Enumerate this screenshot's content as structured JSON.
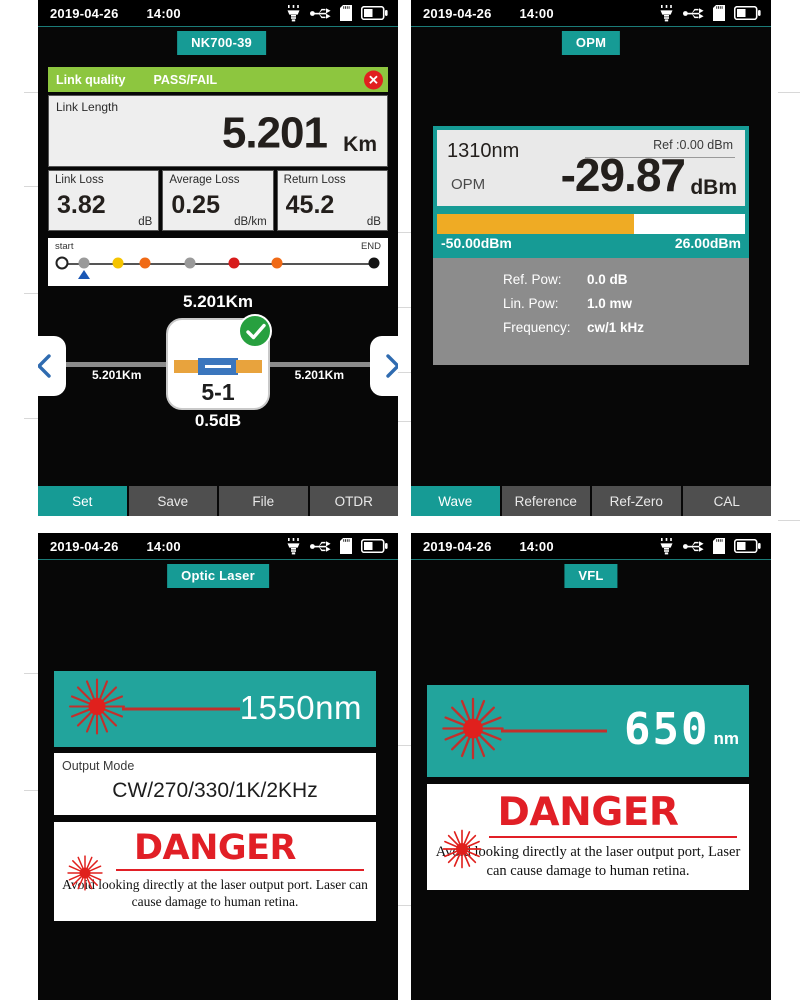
{
  "sheet": {
    "background": "#ffffff",
    "accent_teal": "#169b95",
    "danger_red": "#e11f26",
    "pass_green": "#8dc63f"
  },
  "status_bar": {
    "date": "2019-04-26",
    "time": "14:00",
    "icons": [
      "lamp-icon",
      "usb-icon",
      "sd-card-icon",
      "battery-icon"
    ]
  },
  "panel_otdr": {
    "title": "NK700-39",
    "link_quality": {
      "label": "Link quality",
      "verdict": "PASS/FAIL",
      "close_glyph": "✕"
    },
    "link_length": {
      "label": "Link Length",
      "value": "5.201",
      "unit": "Km"
    },
    "metrics": [
      {
        "label": "Link Loss",
        "value": "3.82",
        "unit": "dB"
      },
      {
        "label": "Average Loss",
        "value": "0.25",
        "unit": "dB/km"
      },
      {
        "label": "Return Loss",
        "value": "45.2",
        "unit": "dB"
      }
    ],
    "track": {
      "start_label": "start",
      "end_label": "END",
      "cursor_position_pct": 7,
      "events": [
        {
          "pos_pct": 0,
          "color": "#ffffff",
          "hollow": true
        },
        {
          "pos_pct": 7,
          "color": "#9a9a9a",
          "hollow": false
        },
        {
          "pos_pct": 18,
          "color": "#f5c400",
          "hollow": false
        },
        {
          "pos_pct": 26.5,
          "color": "#f06a16",
          "hollow": false
        },
        {
          "pos_pct": 41,
          "color": "#9a9a9a",
          "hollow": false
        },
        {
          "pos_pct": 55,
          "color": "#d81b1b",
          "hollow": false
        },
        {
          "pos_pct": 69,
          "color": "#f06a16",
          "hollow": false
        },
        {
          "pos_pct": 100,
          "color": "#141414",
          "hollow": false
        }
      ]
    },
    "total_distance": "5.201Km",
    "event_detail": {
      "left_distance": "5.201Km",
      "right_distance": "5.201Km",
      "event_id": "5-1",
      "loss": "0.5dB",
      "status": "pass",
      "prev_glyph": "‹",
      "next_glyph": "›"
    },
    "toolbar": [
      {
        "label": "Set",
        "active": true
      },
      {
        "label": "Save",
        "active": false
      },
      {
        "label": "File",
        "active": false
      },
      {
        "label": "OTDR",
        "active": false
      }
    ]
  },
  "panel_opm": {
    "title": "OPM",
    "wavelength": "1310nm",
    "mode_tag": "OPM",
    "reference": "Ref :0.00  dBm",
    "value": "-29.87",
    "unit": "dBm",
    "gauge": {
      "min_label": "-50.00dBm",
      "max_label": "26.00dBm",
      "fill_pct": 64
    },
    "info": [
      {
        "key": "Ref. Pow:",
        "value": "0.0 dB"
      },
      {
        "key": "Lin. Pow:",
        "value": "1.0 mw"
      },
      {
        "key": "Frequency:",
        "value": "cw/1 kHz"
      }
    ],
    "toolbar": [
      {
        "label": "Wave",
        "active": true
      },
      {
        "label": "Reference",
        "active": false
      },
      {
        "label": "Ref-Zero",
        "active": false
      },
      {
        "label": "CAL",
        "active": false
      }
    ]
  },
  "panel_optic_laser": {
    "title": "Optic Laser",
    "wavelength": "1550nm",
    "output_mode": {
      "label": "Output Mode",
      "value": "CW/270/330/1K/2KHz"
    },
    "danger": {
      "title": "DANGER",
      "text": "Avoid looking directly at the laser output port. Laser can cause damage to human retina."
    }
  },
  "panel_vfl": {
    "title": "VFL",
    "wavelength_digits": "650",
    "wavelength_unit": "nm",
    "danger": {
      "title": "DANGER",
      "text": "Avoid looking directly at the laser output port, Laser can cause damage to human retina."
    }
  }
}
